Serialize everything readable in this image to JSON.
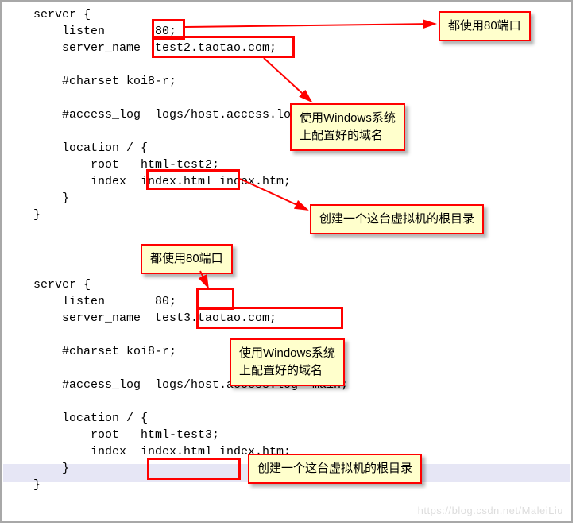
{
  "code_block_1": "server {\n    listen       80;\n    server_name  test2.taotao.com;\n\n    #charset koi8-r;\n\n    #access_log  logs/host.access.log  main;\n\n    location / {\n        root   html-test2;\n        index  index.html index.htm;\n    }\n}",
  "code_block_2": "server {\n    listen       80;\n    server_name  test3.taotao.com;\n\n    #charset koi8-r;\n\n    #access_log  logs/host.access.log  main;\n\n    location / {\n        root   html-test3;\n        index  index.html index.htm;\n    }\n}",
  "annotation_port_1": "都使用80端口",
  "annotation_domain_1": "使用Windows系统\n上配置好的域名",
  "annotation_root_1": "创建一个这台虚拟机的根目录",
  "annotation_port_2": "都使用80端口",
  "annotation_domain_2": "使用Windows系统\n上配置好的域名",
  "annotation_root_2": "创建一个这台虚拟机的根目录",
  "watermark": "https://blog.csdn.net/MaleiLiu"
}
